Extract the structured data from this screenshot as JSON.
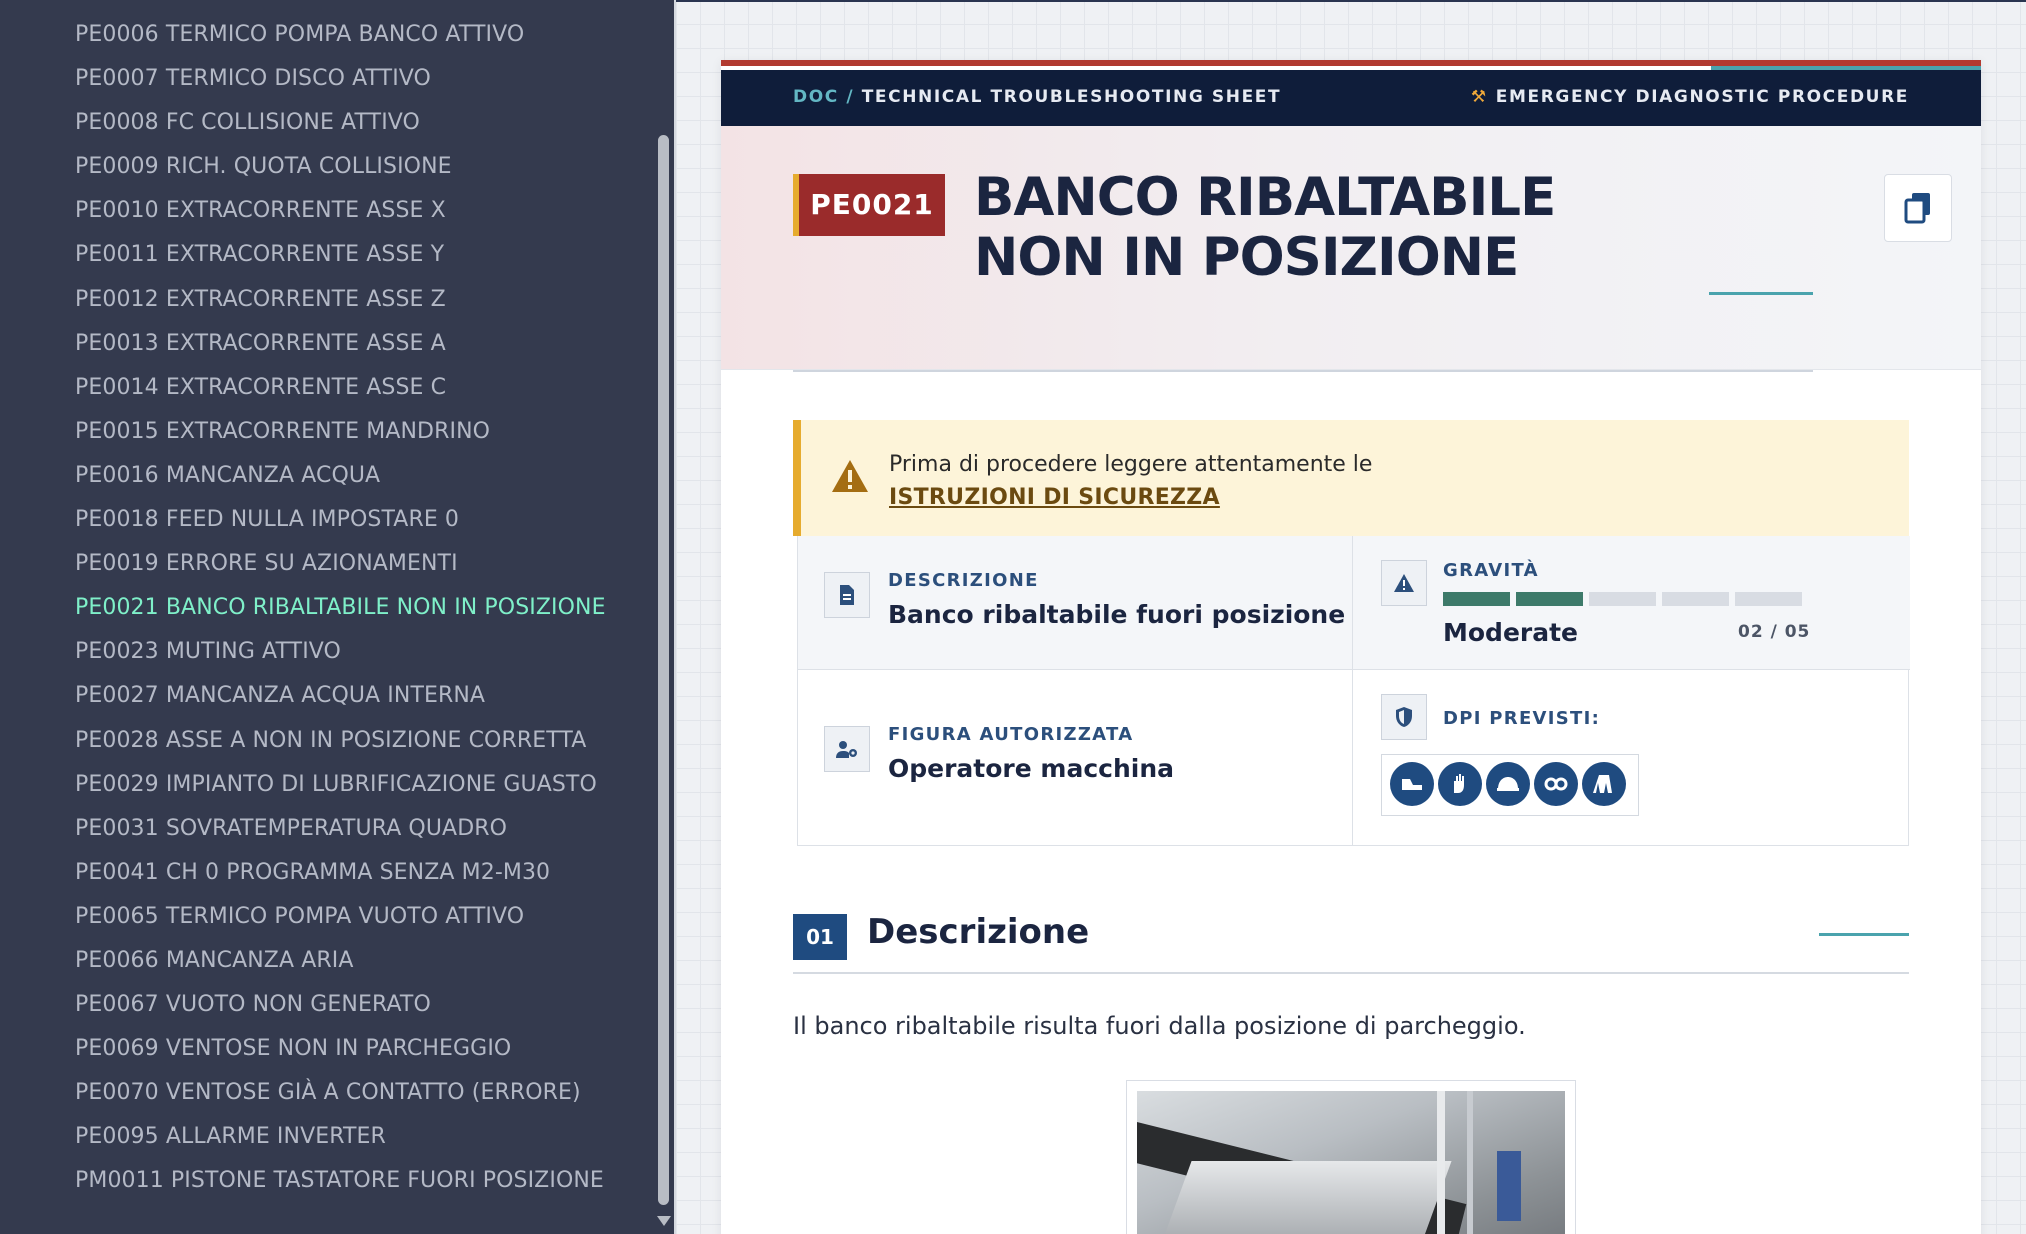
{
  "sidebar": {
    "items": [
      "PE0006 TERMICO POMPA BANCO ATTIVO",
      "PE0007 TERMICO DISCO ATTIVO",
      "PE0008 FC COLLISIONE ATTIVO",
      "PE0009 RICH. QUOTA COLLISIONE",
      "PE0010 EXTRACORRENTE ASSE X",
      "PE0011 EXTRACORRENTE ASSE Y",
      "PE0012 EXTRACORRENTE ASSE Z",
      "PE0013 EXTRACORRENTE ASSE A",
      "PE0014 EXTRACORRENTE ASSE C",
      "PE0015 EXTRACORRENTE MANDRINO",
      "PE0016 MANCANZA ACQUA",
      "PE0018 FEED NULLA IMPOSTARE 0",
      "PE0019 ERRORE SU AZIONAMENTI",
      "PE0021 BANCO RIBALTABILE NON IN POSIZIONE",
      "PE0023 MUTING ATTIVO",
      "PE0027 MANCANZA ACQUA INTERNA",
      "PE0028 ASSE A NON IN POSIZIONE CORRETTA",
      "PE0029 IMPIANTO DI LUBRIFICAZIONE GUASTO",
      "PE0031 SOVRATEMPERATURA QUADRO",
      "PE0041 CH 0 PROGRAMMA SENZA M2-M30",
      "PE0065 TERMICO POMPA VUOTO ATTIVO",
      "PE0066 MANCANZA ARIA",
      "PE0067 VUOTO NON GENERATO",
      "PE0069 VENTOSE NON IN PARCHEGGIO",
      "PE0070 VENTOSE GIÀ A CONTATTO (ERRORE)",
      "PE0095 ALLARME INVERTER",
      "PM0011 PISTONE TASTATORE FUORI POSIZIONE"
    ],
    "active_index": 13,
    "active_color": "#7ff0c9"
  },
  "header": {
    "crumb_root": "DOC /",
    "crumb_page": "TECHNICAL TROUBLESHOOTING SHEET",
    "procedure": "EMERGENCY DIAGNOSTIC PROCEDURE",
    "procedure_icon": "wrench-icon"
  },
  "hero": {
    "code": "PE0021",
    "title": "BANCO RIBALTABILE NON IN POSIZIONE",
    "copy_icon": "copy-icon"
  },
  "warning": {
    "text": "Prima di procedere leggere attentamente le",
    "link": "ISTRUZIONI DI SICUREZZA"
  },
  "info": {
    "descrizione_label": "DESCRIZIONE",
    "descrizione_value": "Banco ribaltabile fuori posizione",
    "gravita_label": "GRAVITÀ",
    "gravita_value": "Moderate",
    "gravita_count": "02 / 05",
    "gravita_level": 2,
    "gravita_max": 5,
    "figura_label": "FIGURA AUTORIZZATA",
    "figura_value": "Operatore macchina",
    "dpi_label": "DPI PREVISTI:",
    "dpi_icons": [
      "safety-shoes-icon",
      "gloves-icon",
      "helmet-icon",
      "goggles-icon",
      "coverall-icon"
    ]
  },
  "section": {
    "number": "01",
    "title": "Descrizione",
    "body": "Il banco ribaltabile risulta fuori dalla posizione di parcheggio."
  },
  "colors": {
    "sidebar_bg": "#343a4e",
    "accent_red": "#9a2b2b",
    "accent_gold": "#e6ab2e",
    "navy": "#0f1d3a",
    "teal": "#4aa3ad",
    "severity_on": "#3d7a6a"
  }
}
